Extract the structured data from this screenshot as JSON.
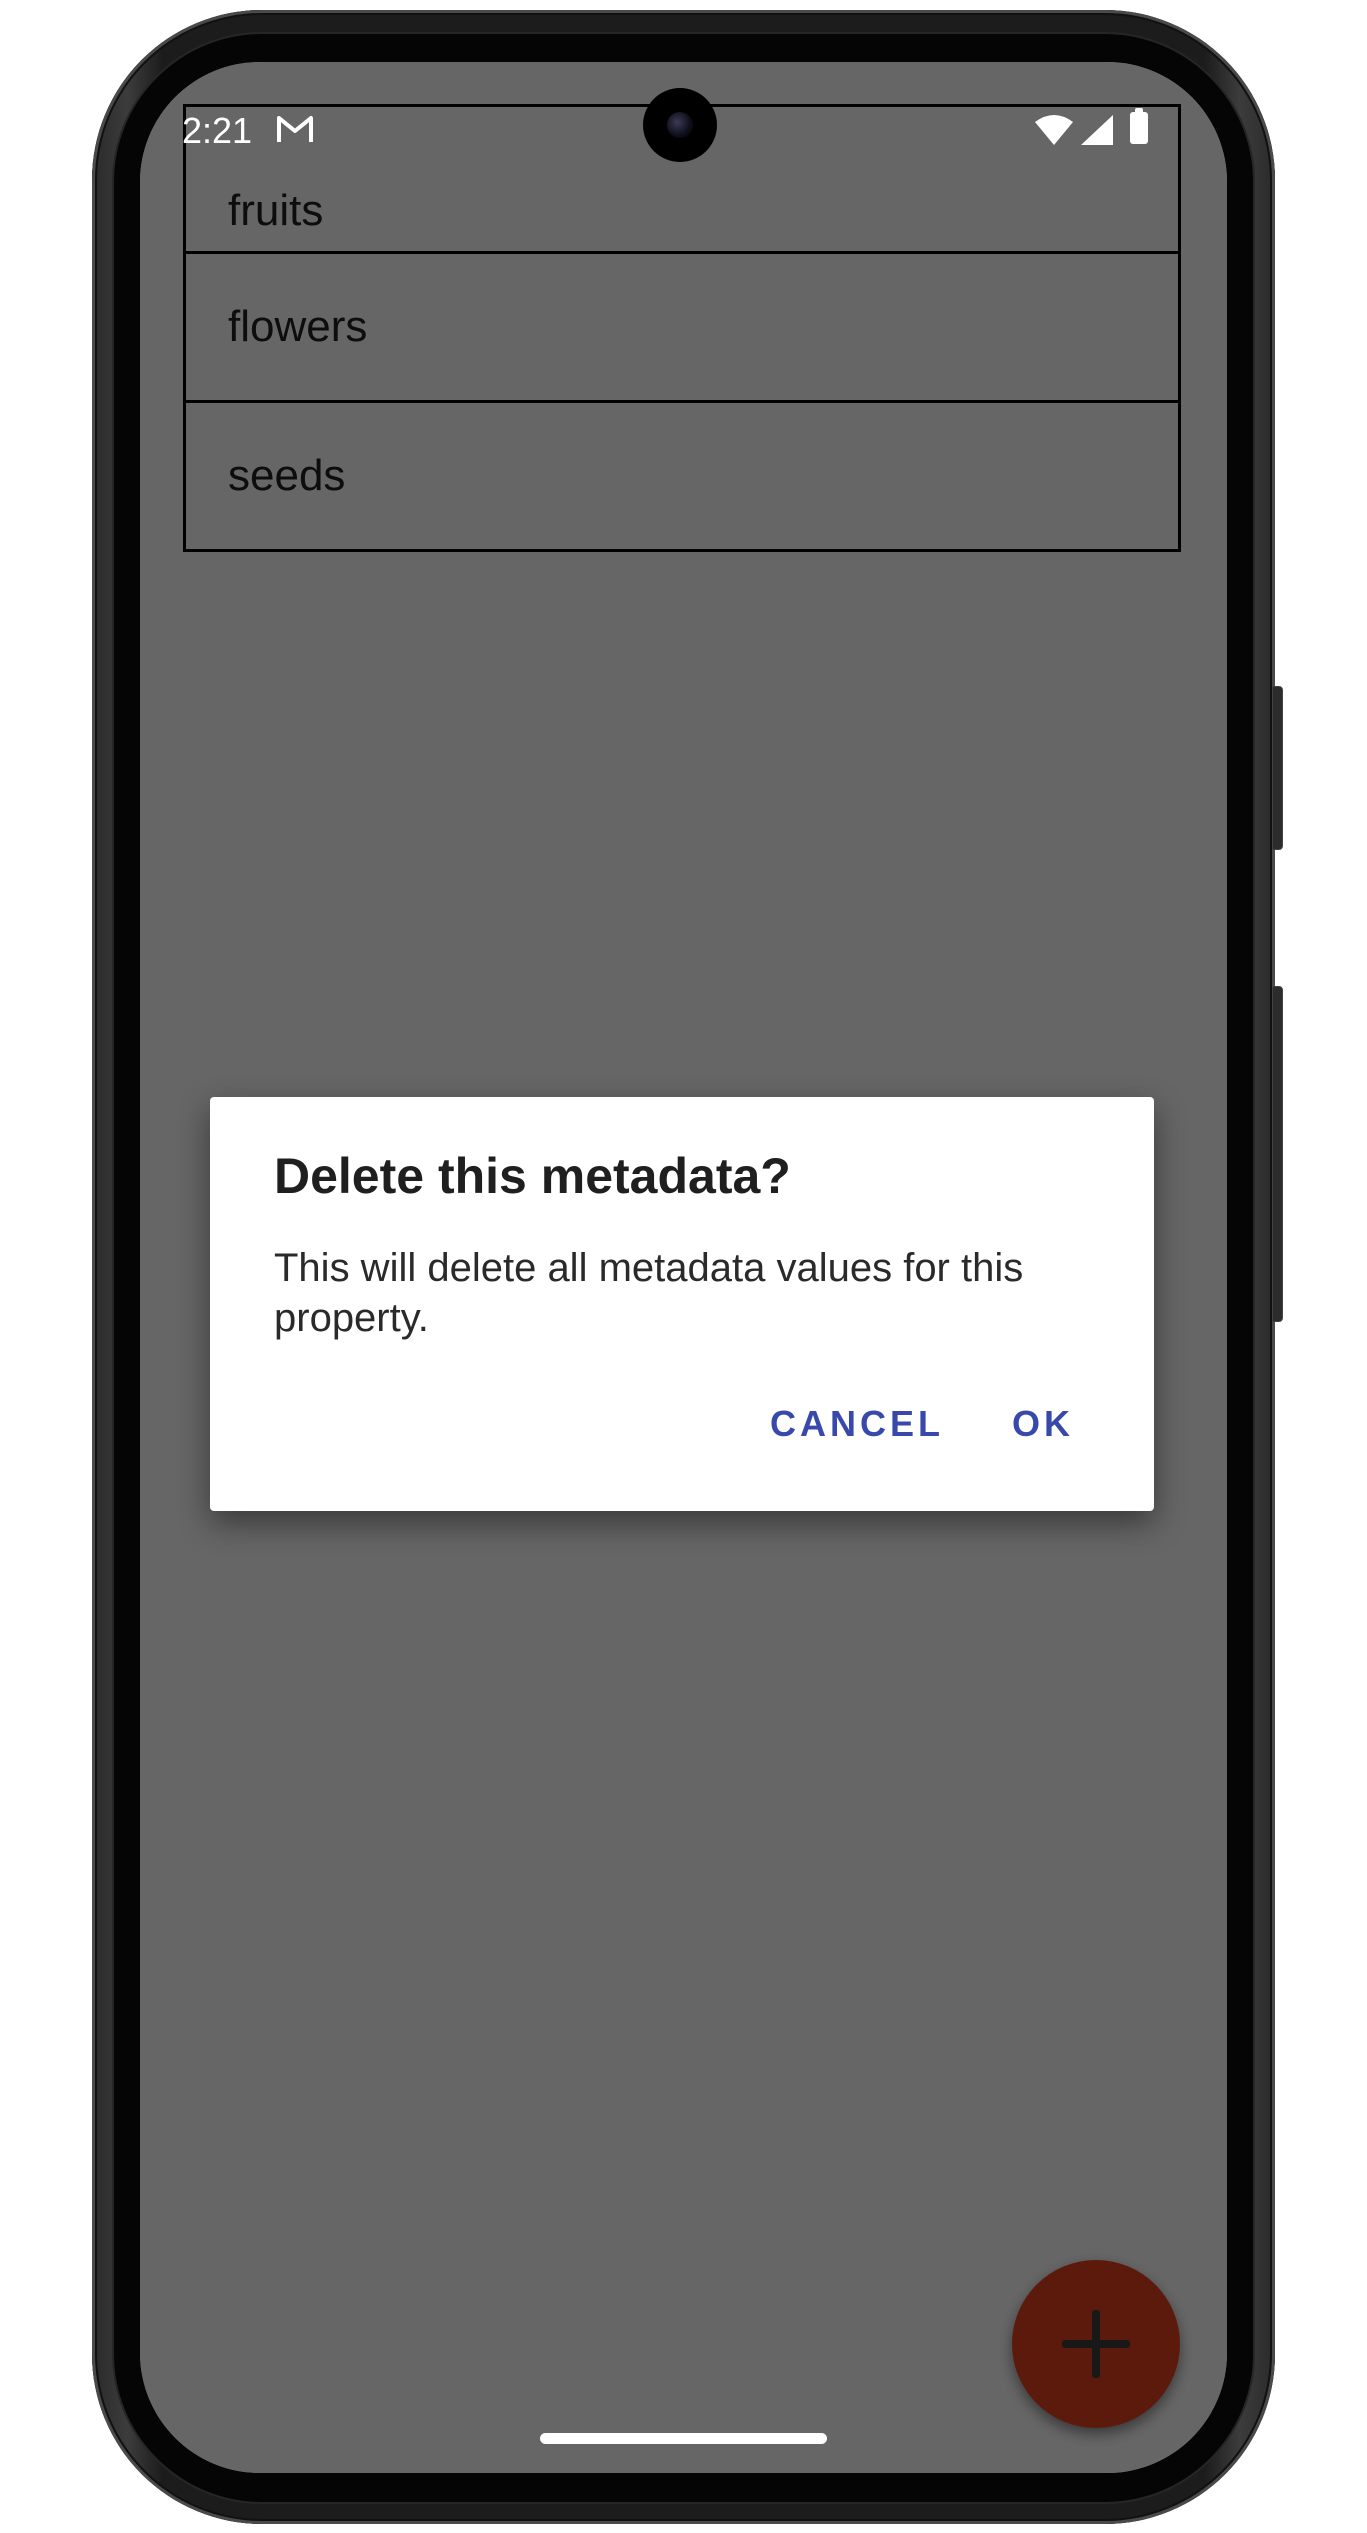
{
  "status_bar": {
    "time": "2:21",
    "notification_icon": "gmail-icon",
    "icons": [
      "wifi-icon",
      "signal-icon",
      "battery-icon"
    ]
  },
  "list": {
    "items": [
      {
        "label": "fruits"
      },
      {
        "label": "flowers"
      },
      {
        "label": "seeds"
      }
    ]
  },
  "dialog": {
    "title": "Delete this metadata?",
    "message": "This will delete all metadata values for this property.",
    "cancel_label": "CANCEL",
    "ok_label": "OK"
  },
  "fab": {
    "icon": "plus-icon"
  },
  "colors": {
    "accent": "#3949ab",
    "fab": "#e5411e",
    "scrim": "rgba(0,0,0,0.6)"
  }
}
